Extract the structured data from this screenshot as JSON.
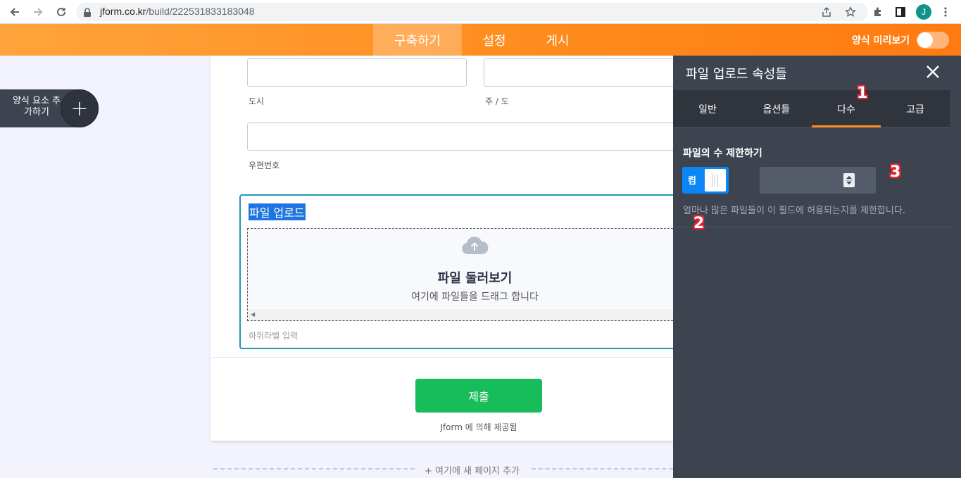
{
  "browser": {
    "url_host": "jform.co.kr",
    "url_path": "/build/222531833183048",
    "profile_initial": "J"
  },
  "appbar": {
    "tabs": [
      {
        "label": "구축하기",
        "active": true
      },
      {
        "label": "설정",
        "active": false
      },
      {
        "label": "게시",
        "active": false
      }
    ],
    "preview_label": "양식 미리보기"
  },
  "add_element": {
    "label": "양식 요소 추가하기",
    "plus": "+"
  },
  "form": {
    "city_label": "도시",
    "state_label": "주 / 도",
    "zip_label": "우편번호",
    "upload": {
      "title": "파일 업로드",
      "browse_label": "파일 둘러보기",
      "drag_label": "여기에 파일들을 드래그 합니다",
      "sublabel_placeholder": "하위라벨 입력"
    },
    "submit_label": "제출",
    "powered_by": "Jform 에 의해 제공됨",
    "add_page_label": "+ 여기에 새 페이지 추가"
  },
  "panel": {
    "title": "파일 업로드 속성들",
    "tabs": [
      {
        "label": "일반",
        "active": false
      },
      {
        "label": "옵션들",
        "active": false
      },
      {
        "label": "다수",
        "active": true
      },
      {
        "label": "고급",
        "active": false
      }
    ],
    "limit": {
      "title": "파일의 수 제한하기",
      "toggle_on_label": "켬",
      "toggle_state": true,
      "value": "",
      "help": "얼마나 많은 파일들이 이 필드에 허용되는지를 제한합니다."
    }
  },
  "annotations": [
    "1",
    "2",
    "3"
  ],
  "colors": {
    "header_orange": "#ff8a1c",
    "panel_bg": "#3d4450",
    "submit_green": "#18bd5b",
    "toggle_blue": "#0a87f5",
    "upload_border": "#2196b6"
  }
}
